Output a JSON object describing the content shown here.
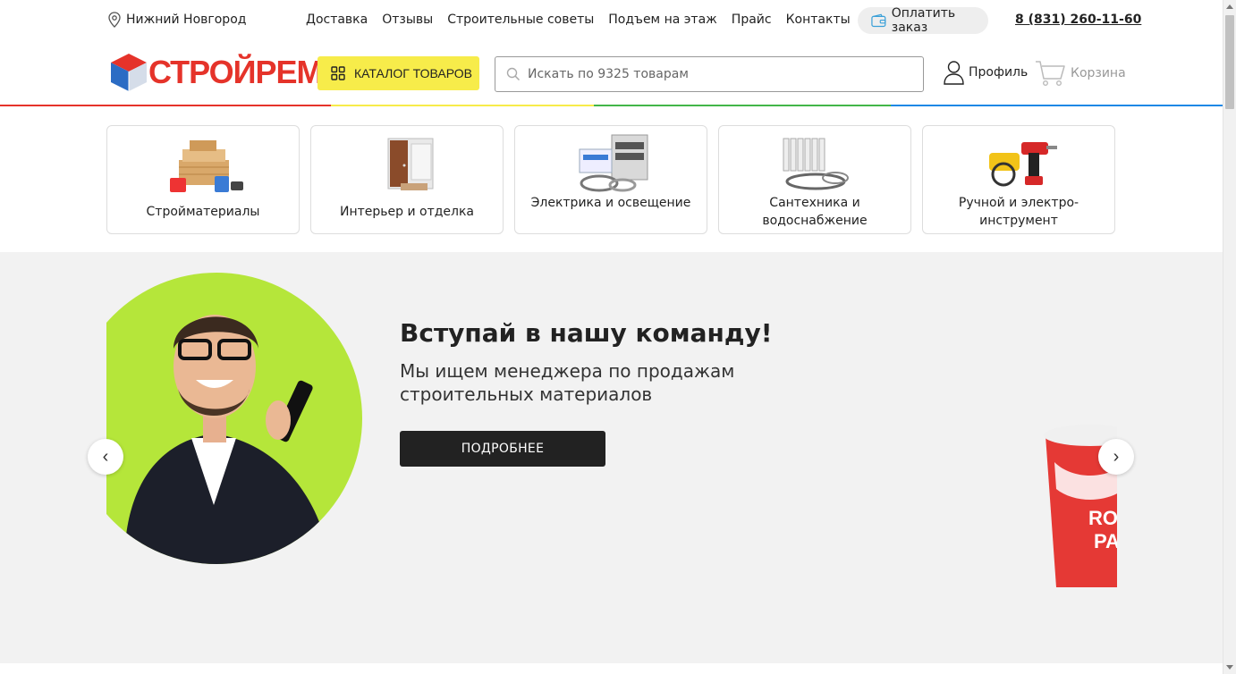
{
  "topbar": {
    "city": "Нижний Новгород",
    "nav": [
      "Доставка",
      "Отзывы",
      "Строительные советы",
      "Подъем на этаж",
      "Прайс",
      "Контакты"
    ],
    "pay_label": "Оплатить заказ",
    "phone": "8 (831) 260-11-60"
  },
  "header": {
    "logo_text": "СТРОЙРЕМ",
    "catalog_label": "КАТАЛОГ ТОВАРОВ",
    "search_placeholder": "Искать по 9325 товарам",
    "profile_label": "Профиль",
    "cart_label": "Корзина"
  },
  "stripe_colors": [
    "#e5332a",
    "#f7ec4a",
    "#43b649",
    "#1e88e5"
  ],
  "categories": [
    {
      "label": "Стройматериалы",
      "icon": "lumber-icon"
    },
    {
      "label": "Интерьер и отделка",
      "icon": "door-icon"
    },
    {
      "label": "Электрика и освещение",
      "icon": "electrical-panel-icon"
    },
    {
      "label": "Сантехника и водоснабжение",
      "icon": "radiator-icon"
    },
    {
      "label": "Ручной и электро-инструмент",
      "icon": "power-tools-icon"
    }
  ],
  "banner": {
    "title": "Вступай в нашу команду!",
    "subtitle": "Мы ищем менеджера по продажам строительных материалов",
    "button": "ПОДРОБНЕЕ",
    "prev": "‹",
    "next": "›",
    "accent": "#b5e63a"
  }
}
